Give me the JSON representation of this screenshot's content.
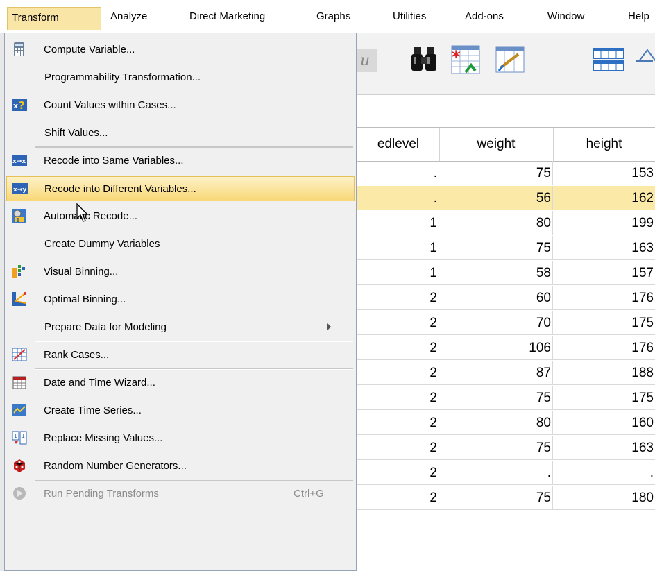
{
  "menubar": {
    "items": [
      "Transform",
      "Analyze",
      "Direct Marketing",
      "Graphs",
      "Utilities",
      "Add-ons",
      "Window",
      "Help"
    ]
  },
  "dropdown": {
    "items": [
      {
        "label": "Compute Variable...",
        "icon": "calculator-icon"
      },
      {
        "label": "Programmability Transformation...",
        "icon": ""
      },
      {
        "label": "Count Values within Cases...",
        "icon": "count-values-icon"
      },
      {
        "label": "Shift Values...",
        "icon": ""
      },
      {
        "label": "Recode into Same Variables...",
        "icon": "recode-same-icon"
      },
      {
        "label": "Recode into Different Variables...",
        "icon": "recode-different-icon"
      },
      {
        "label": "Automatic Recode...",
        "icon": "automatic-recode-icon"
      },
      {
        "label": "Create Dummy Variables",
        "icon": ""
      },
      {
        "label": "Visual Binning...",
        "icon": "visual-binning-icon"
      },
      {
        "label": "Optimal Binning...",
        "icon": "optimal-binning-icon"
      },
      {
        "label": "Prepare Data for Modeling",
        "icon": ""
      },
      {
        "label": "Rank Cases...",
        "icon": "rank-cases-icon"
      },
      {
        "label": "Date and Time Wizard...",
        "icon": "calendar-icon"
      },
      {
        "label": "Create Time Series...",
        "icon": "time-series-icon"
      },
      {
        "label": "Replace Missing Values...",
        "icon": "replace-missing-icon"
      },
      {
        "label": "Random Number Generators...",
        "icon": "dice-icon"
      },
      {
        "label": "Run Pending Transforms",
        "icon": "run-pending-icon",
        "shortcut": "Ctrl+G"
      }
    ]
  },
  "grid": {
    "columns": [
      "edlevel",
      "weight",
      "height"
    ],
    "rows": [
      [
        ".",
        "75",
        "153"
      ],
      [
        ".",
        "56",
        "162"
      ],
      [
        "1",
        "80",
        "199"
      ],
      [
        "1",
        "75",
        "163"
      ],
      [
        "1",
        "58",
        "157"
      ],
      [
        "2",
        "60",
        "176"
      ],
      [
        "2",
        "70",
        "175"
      ],
      [
        "2",
        "106",
        "176"
      ],
      [
        "2",
        "87",
        "188"
      ],
      [
        "2",
        "75",
        "175"
      ],
      [
        "2",
        "80",
        "160"
      ],
      [
        "2",
        "75",
        "163"
      ],
      [
        "2",
        ".",
        "."
      ],
      [
        "2",
        "75",
        "180"
      ]
    ]
  },
  "colors": {
    "highlight": "#f8d877",
    "menu_bg": "#f0f0f0",
    "selected_row": "#fbe9a8"
  }
}
